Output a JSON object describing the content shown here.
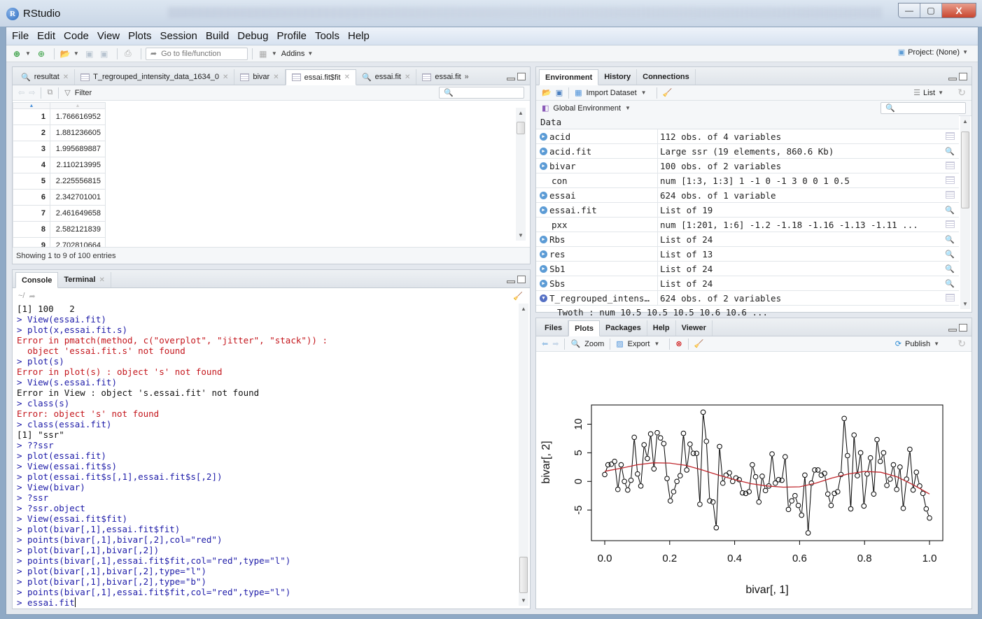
{
  "window": {
    "title": "RStudio",
    "logo_letter": "R",
    "controls": {
      "minimize": "—",
      "maximize": "▢",
      "close": "X"
    }
  },
  "menu": [
    "File",
    "Edit",
    "Code",
    "View",
    "Plots",
    "Session",
    "Build",
    "Debug",
    "Profile",
    "Tools",
    "Help"
  ],
  "toolbar": {
    "goto_placeholder": "Go to file/function",
    "addins_label": "Addins",
    "project_label": "Project: (None)"
  },
  "source_pane": {
    "tabs": [
      {
        "label": "resultat",
        "icon": "search-icon",
        "closable": true,
        "active": false
      },
      {
        "label": "T_regrouped_intensity_data_1634_0",
        "icon": "grid-icon",
        "closable": true,
        "active": false
      },
      {
        "label": "bivar",
        "icon": "grid-icon",
        "closable": true,
        "active": false
      },
      {
        "label": "essai.fit$fit",
        "icon": "grid-icon",
        "closable": true,
        "active": true
      },
      {
        "label": "essai.fit",
        "icon": "search-icon",
        "closable": true,
        "active": false
      },
      {
        "label": "essai.fit",
        "icon": "grid-icon",
        "closable": false,
        "active": false
      }
    ],
    "more_tabs": "»",
    "filter_label": "Filter",
    "rows": [
      {
        "n": "1",
        "v": "1.766616952"
      },
      {
        "n": "2",
        "v": "1.881236605"
      },
      {
        "n": "3",
        "v": "1.995689887"
      },
      {
        "n": "4",
        "v": "2.110213995"
      },
      {
        "n": "5",
        "v": "2.225556815"
      },
      {
        "n": "6",
        "v": "2.342701001"
      },
      {
        "n": "7",
        "v": "2.461649658"
      },
      {
        "n": "8",
        "v": "2.582121839"
      },
      {
        "n": "9",
        "v": "2.702810664"
      }
    ],
    "status": "Showing 1 to 9 of 100 entries"
  },
  "console_pane": {
    "tabs": [
      {
        "label": "Console",
        "active": true,
        "closable": false
      },
      {
        "label": "Terminal",
        "active": false,
        "closable": true
      }
    ],
    "path": "~/",
    "lines": [
      {
        "type": "out",
        "text": "[1] 100   2"
      },
      {
        "type": "cmd",
        "text": "> View(essai.fit)"
      },
      {
        "type": "cmd",
        "text": "> plot(x,essai.fit.s)"
      },
      {
        "type": "err",
        "text": "Error in pmatch(method, c(\"overplot\", \"jitter\", \"stack\")) :"
      },
      {
        "type": "err",
        "text": "  object 'essai.fit.s' not found"
      },
      {
        "type": "cmd",
        "text": "> plot(s)"
      },
      {
        "type": "err",
        "text": "Error in plot(s) : object 's' not found"
      },
      {
        "type": "cmd",
        "text": "> View(s.essai.fit)"
      },
      {
        "type": "out",
        "text": "Error in View : object 's.essai.fit' not found"
      },
      {
        "type": "cmd",
        "text": "> class(s)"
      },
      {
        "type": "err",
        "text": "Error: object 's' not found"
      },
      {
        "type": "cmd",
        "text": "> class(essai.fit)"
      },
      {
        "type": "out",
        "text": "[1] \"ssr\""
      },
      {
        "type": "cmd",
        "text": "> ??ssr"
      },
      {
        "type": "cmd",
        "text": "> plot(essai.fit)"
      },
      {
        "type": "cmd",
        "text": "> View(essai.fit$s)"
      },
      {
        "type": "cmd",
        "text": "> plot(essai.fit$s[,1],essai.fit$s[,2])"
      },
      {
        "type": "cmd",
        "text": "> View(bivar)"
      },
      {
        "type": "cmd",
        "text": "> ?ssr"
      },
      {
        "type": "cmd",
        "text": "> ?ssr.object"
      },
      {
        "type": "cmd",
        "text": "> View(essai.fit$fit)"
      },
      {
        "type": "cmd",
        "text": "> plot(bivar[,1],essai.fit$fit)"
      },
      {
        "type": "cmd",
        "text": "> points(bivar[,1],bivar[,2],col=\"red\")"
      },
      {
        "type": "cmd",
        "text": "> plot(bivar[,1],bivar[,2])"
      },
      {
        "type": "cmd",
        "text": "> points(bivar[,1],essai.fit$fit,col=\"red\",type=\"l\")"
      },
      {
        "type": "cmd",
        "text": "> plot(bivar[,1],bivar[,2],type=\"l\")"
      },
      {
        "type": "cmd",
        "text": "> plot(bivar[,1],bivar[,2],type=\"b\")"
      },
      {
        "type": "cmd",
        "text": "> points(bivar[,1],essai.fit$fit,col=\"red\",type=\"l\")"
      }
    ],
    "current_input": "> essai.fit"
  },
  "env_pane": {
    "tabs": [
      {
        "label": "Environment",
        "active": true
      },
      {
        "label": "History",
        "active": false
      },
      {
        "label": "Connections",
        "active": false
      }
    ],
    "import_label": "Import Dataset",
    "view_mode": "List",
    "scope": "Global Environment",
    "section": "Data",
    "rows": [
      {
        "name": "acid",
        "value": "112 obs. of 4 variables",
        "expand": "closed",
        "action": "grid"
      },
      {
        "name": "acid.fit",
        "value": "Large ssr (19 elements, 860.6 Kb)",
        "expand": "closed",
        "action": "search"
      },
      {
        "name": "bivar",
        "value": "100 obs. of 2 variables",
        "expand": "closed",
        "action": "grid"
      },
      {
        "name": "con",
        "value": "num [1:3, 1:3] 1 -1 0 -1 3 0 0 1 0.5",
        "expand": "none",
        "action": "grid"
      },
      {
        "name": "essai",
        "value": "624 obs. of 1 variable",
        "expand": "closed",
        "action": "grid"
      },
      {
        "name": "essai.fit",
        "value": "List of 19",
        "expand": "closed",
        "action": "search"
      },
      {
        "name": "pxx",
        "value": "num [1:201, 1:6] -1.2 -1.18 -1.16 -1.13 -1.11 ...",
        "expand": "none",
        "action": "grid"
      },
      {
        "name": "Rbs",
        "value": "List of 24",
        "expand": "closed",
        "action": "search"
      },
      {
        "name": "res",
        "value": "List of 13",
        "expand": "closed",
        "action": "search"
      },
      {
        "name": "Sb1",
        "value": "List of 24",
        "expand": "closed",
        "action": "search"
      },
      {
        "name": "Sbs",
        "value": "List of 24",
        "expand": "closed",
        "action": "search"
      },
      {
        "name": "T_regrouped_intens…",
        "value": "624 obs. of 2 variables",
        "expand": "open",
        "action": "grid"
      }
    ],
    "sub_row": "Twoth : num 10.5 10.5 10.5 10.6 10.6 ..."
  },
  "plots_pane": {
    "tabs": [
      {
        "label": "Files",
        "active": false
      },
      {
        "label": "Plots",
        "active": true
      },
      {
        "label": "Packages",
        "active": false
      },
      {
        "label": "Help",
        "active": false
      },
      {
        "label": "Viewer",
        "active": false
      }
    ],
    "zoom_label": "Zoom",
    "export_label": "Export",
    "publish_label": "Publish"
  },
  "chart_data": {
    "type": "line",
    "title": "",
    "xlabel": "bivar[, 1]",
    "ylabel": "bivar[, 2]",
    "xlim": [
      0.0,
      1.0
    ],
    "ylim": [
      -9.5,
      12.5
    ],
    "xticks": [
      "0.0",
      "0.2",
      "0.4",
      "0.6",
      "0.8",
      "1.0"
    ],
    "yticks": [
      "-5",
      "0",
      "5",
      "10"
    ],
    "grid": false,
    "series": [
      {
        "name": "bivar[,2]",
        "style": "type b (points and lines)",
        "color": "#000000",
        "x": [
          0.0,
          0.0101,
          0.0202,
          0.0303,
          0.0404,
          0.0505,
          0.0606,
          0.0707,
          0.0808,
          0.0909,
          0.101,
          0.1111,
          0.1212,
          0.1313,
          0.1414,
          0.1515,
          0.1616,
          0.1717,
          0.1818,
          0.1919,
          0.202,
          0.2121,
          0.2222,
          0.2323,
          0.2424,
          0.2525,
          0.2626,
          0.2727,
          0.2828,
          0.2929,
          0.303,
          0.3131,
          0.3232,
          0.3333,
          0.3434,
          0.3535,
          0.3636,
          0.3737,
          0.3838,
          0.3939,
          0.404,
          0.4141,
          0.4242,
          0.4343,
          0.4444,
          0.4545,
          0.4646,
          0.4747,
          0.4848,
          0.4949,
          0.5051,
          0.5152,
          0.5253,
          0.5354,
          0.5455,
          0.5556,
          0.5657,
          0.5758,
          0.5859,
          0.596,
          0.6061,
          0.6162,
          0.6263,
          0.6364,
          0.6465,
          0.6566,
          0.6667,
          0.6768,
          0.6869,
          0.697,
          0.7071,
          0.7172,
          0.7273,
          0.7374,
          0.7475,
          0.7576,
          0.7677,
          0.7778,
          0.7879,
          0.798,
          0.8081,
          0.8182,
          0.8283,
          0.8384,
          0.8485,
          0.8586,
          0.8687,
          0.8788,
          0.8889,
          0.899,
          0.9091,
          0.9192,
          0.9293,
          0.9394,
          0.9495,
          0.9596,
          0.9697,
          0.9798,
          0.9899,
          1.0
        ],
        "y": [
          1.2,
          2.9,
          3.0,
          3.5,
          -1.4,
          2.9,
          0.0,
          -1.5,
          0.2,
          7.7,
          1.3,
          -0.8,
          6.4,
          4.0,
          8.3,
          2.2,
          8.5,
          7.6,
          6.6,
          0.5,
          -3.4,
          -1.8,
          0.0,
          1.0,
          8.4,
          2.0,
          6.5,
          4.9,
          4.9,
          -4.0,
          12.1,
          7.0,
          -3.4,
          -3.6,
          -8.1,
          6.1,
          -0.3,
          1.1,
          1.5,
          0.0,
          0.6,
          0.3,
          -2.0,
          -2.1,
          -1.8,
          2.9,
          0.8,
          -3.6,
          0.9,
          -1.6,
          -0.8,
          4.8,
          -0.3,
          0.3,
          0.2,
          4.3,
          -4.9,
          -3.4,
          -2.5,
          -4.2,
          -5.9,
          1.1,
          -9.0,
          -0.3,
          2.0,
          2.0,
          1.1,
          1.4,
          -2.2,
          -4.2,
          -2.1,
          -1.8,
          1.2,
          11.0,
          4.5,
          -4.8,
          8.1,
          1.0,
          5.0,
          -4.3,
          1.3,
          4.1,
          -2.2,
          7.3,
          3.5,
          5.0,
          -0.7,
          0.4,
          2.9,
          -1.4,
          2.5,
          -4.7,
          0.4,
          5.6,
          -1.5,
          1.6,
          -0.8,
          -2.1,
          -4.8,
          -6.4
        ]
      },
      {
        "name": "essai.fit$fit",
        "style": "line",
        "color": "#c0272d",
        "x": [
          0.0,
          0.05,
          0.1,
          0.15,
          0.2,
          0.25,
          0.3,
          0.35,
          0.4,
          0.45,
          0.5,
          0.55,
          0.6,
          0.65,
          0.7,
          0.75,
          0.8,
          0.85,
          0.9,
          0.95,
          1.0
        ],
        "y": [
          1.77,
          2.3,
          2.9,
          3.25,
          3.2,
          2.8,
          2.0,
          1.1,
          0.3,
          -0.4,
          -0.8,
          -1.0,
          -0.95,
          -0.3,
          0.6,
          1.3,
          1.75,
          1.6,
          0.8,
          -0.6,
          -2.2
        ]
      }
    ]
  }
}
